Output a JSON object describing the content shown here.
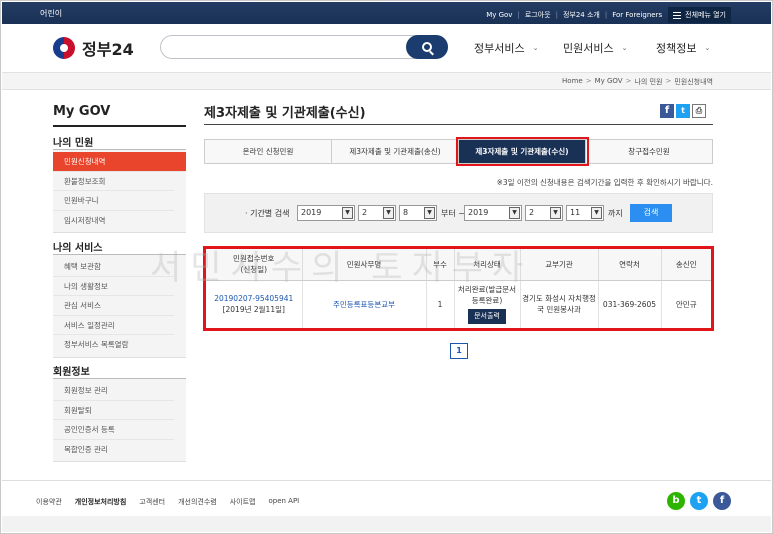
{
  "topbar": {
    "kid": "어린이",
    "links": [
      "My Gov",
      "로그아웃",
      "정부24 소개",
      "For Foreigners"
    ],
    "menu_all": "전체메뉴 열기"
  },
  "header": {
    "logo_text": "정부24",
    "search_placeholder": "",
    "gnb": [
      "정부서비스",
      "민원서비스",
      "정책정보"
    ]
  },
  "breadcrumb": [
    "Home",
    "My GOV",
    "나의 민원",
    "민원신청내역"
  ],
  "sidebar": {
    "title": "My GOV",
    "groups": [
      {
        "title": "나의 민원",
        "items": [
          "민원신청내역",
          "환불정보조회",
          "민원바구니",
          "임시저장내역"
        ],
        "active": 0
      },
      {
        "title": "나의 서비스",
        "items": [
          "혜택 보관함",
          "나의 생활정보",
          "관심 서비스",
          "서비스 일정관리",
          "정부서비스 목록열람"
        ]
      },
      {
        "title": "회원정보",
        "items": [
          "회원정보 관리",
          "회원탈퇴",
          "공인인증서 등록",
          "복합인증 관리"
        ]
      }
    ]
  },
  "main": {
    "title": "제3자제출 및 기관제출(수신)",
    "tabs": [
      "온라인 신청민원",
      "제3자제출 및 기관제출(송신)",
      "제3자제출 및 기관제출(수신)",
      "창구접수민원"
    ],
    "selected_tab": 2,
    "notice": "※3일 이전의 신청내용은 검색기간을 입력한 후 확인하시기 바랍니다.",
    "filter": {
      "label": "· 기간별 검색",
      "from_year": "2019",
      "from_month": "2",
      "from_day": "8",
      "from_text": "부터 ~",
      "to_year": "2019",
      "to_month": "2",
      "to_day": "11",
      "to_text": "까지",
      "search_button": "검색"
    },
    "table": {
      "headers": [
        "민원접수번호\n(신청일)",
        "민원사무명",
        "부수",
        "처리상태",
        "교부기관",
        "연락처",
        "송신인"
      ],
      "rows": [
        {
          "receipt_no": "20190207-95405941",
          "apply_date": "[2019년 2월11일]",
          "name": "주민등록표등본교부",
          "copies": "1",
          "status": "처리완료(발급문서 등록완료)",
          "print_button": "문서출력",
          "agency": "경기도 화성시 자치행정국 민원봉사과",
          "contact": "031-369-2605",
          "sender": "안민규"
        }
      ]
    },
    "watermark": "서민시수의 토지부자",
    "page": "1"
  },
  "footer": {
    "links": [
      "이용약관",
      "개인정보처리방침",
      "고객센터",
      "개선의견수렴",
      "사이트맵",
      "open API"
    ],
    "sns": [
      {
        "icon": "blog-icon",
        "glyph": "b",
        "color": "#2db400"
      },
      {
        "icon": "twitter-icon",
        "glyph": "t",
        "color": "#1da1f2"
      },
      {
        "icon": "facebook-icon",
        "glyph": "f",
        "color": "#3b5998"
      }
    ]
  }
}
